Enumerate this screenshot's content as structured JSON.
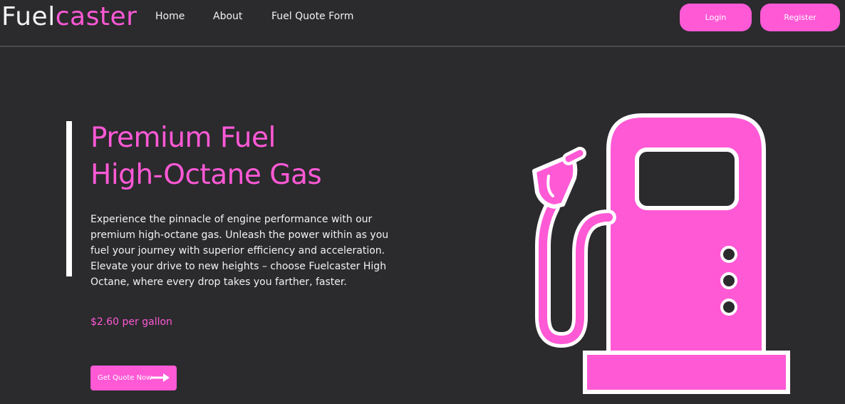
{
  "brand": {
    "part1": "Fuel",
    "part2": "caster"
  },
  "nav": {
    "home": "Home",
    "about": "About",
    "quote_form": "Fuel Quote Form",
    "login": "Login",
    "register": "Register"
  },
  "hero": {
    "title_line1": "Premium Fuel",
    "title_line2": "High-Octane Gas",
    "description": "Experience the pinnacle of engine performance with our premium high-octane gas. Unleash the power within as you fuel your journey with superior efficiency and acceleration. Elevate your drive to new heights – choose Fuelcaster High Octane, where every drop takes you farther, faster.",
    "price": "$2.60 per gallon",
    "cta_label": "Get Quote Now"
  },
  "colors": {
    "background": "#2b2a2d",
    "accent": "#ff59d6",
    "text": "#f2f2f2"
  },
  "icons": {
    "cta_icon": "arrow-right-icon",
    "hero_image": "fuel-pump-icon"
  }
}
